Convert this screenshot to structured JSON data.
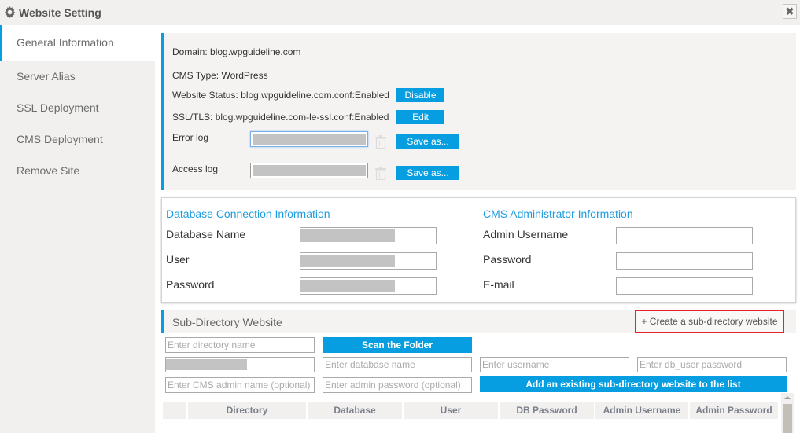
{
  "window": {
    "title": "Website Setting",
    "title_icon": "gear-icon",
    "close_label": "✖"
  },
  "sidebar": {
    "items": [
      {
        "label": "General Information",
        "active": true
      },
      {
        "label": "Server Alias",
        "active": false
      },
      {
        "label": "SSL Deployment",
        "active": false
      },
      {
        "label": "CMS Deployment",
        "active": false
      },
      {
        "label": "Remove Site",
        "active": false
      }
    ]
  },
  "general": {
    "domain": "Domain: blog.wpguideline.com",
    "cms_type": "CMS Type: WordPress",
    "website_status": "Website Status: blog.wpguideline.com.conf:Enabled",
    "disable_label": "Disable",
    "ssl_status": "SSL/TLS: blog.wpguideline.com-le-ssl.conf:Enabled",
    "edit_label": "Edit",
    "error_log_label": "Error log",
    "access_log_label": "Access log",
    "save_as_label": "Save as..."
  },
  "database": {
    "heading": "Database Connection Information",
    "fields": [
      {
        "label": "Database Name"
      },
      {
        "label": "User"
      },
      {
        "label": "Password"
      }
    ]
  },
  "cms_admin": {
    "heading": "CMS Administrator Information",
    "fields": [
      {
        "label": "Admin Username",
        "value": ""
      },
      {
        "label": "Password",
        "value": ""
      },
      {
        "label": "E-mail",
        "value": ""
      }
    ]
  },
  "subdirectory": {
    "title": "Sub-Directory Website",
    "create_label": "+ Create a sub-directory website",
    "directory_placeholder": "Enter directory name",
    "scan_label": "Scan the Folder",
    "database_placeholder": "Enter database name",
    "username_placeholder": "Enter username",
    "db_password_placeholder": "Enter db_user password",
    "cms_admin_placeholder": "Enter CMS admin name (optional)",
    "admin_password_placeholder": "Enter admin password (optional)",
    "add_existing_label": "Add an existing sub-directory website to the list",
    "table_headers": [
      "",
      "Directory",
      "Database",
      "User",
      "DB Password",
      "Admin Username",
      "Admin Password"
    ]
  },
  "colors": {
    "accent": "#069ee0",
    "heading_blue": "#1e9ce0",
    "highlight_red": "#e3242b"
  }
}
